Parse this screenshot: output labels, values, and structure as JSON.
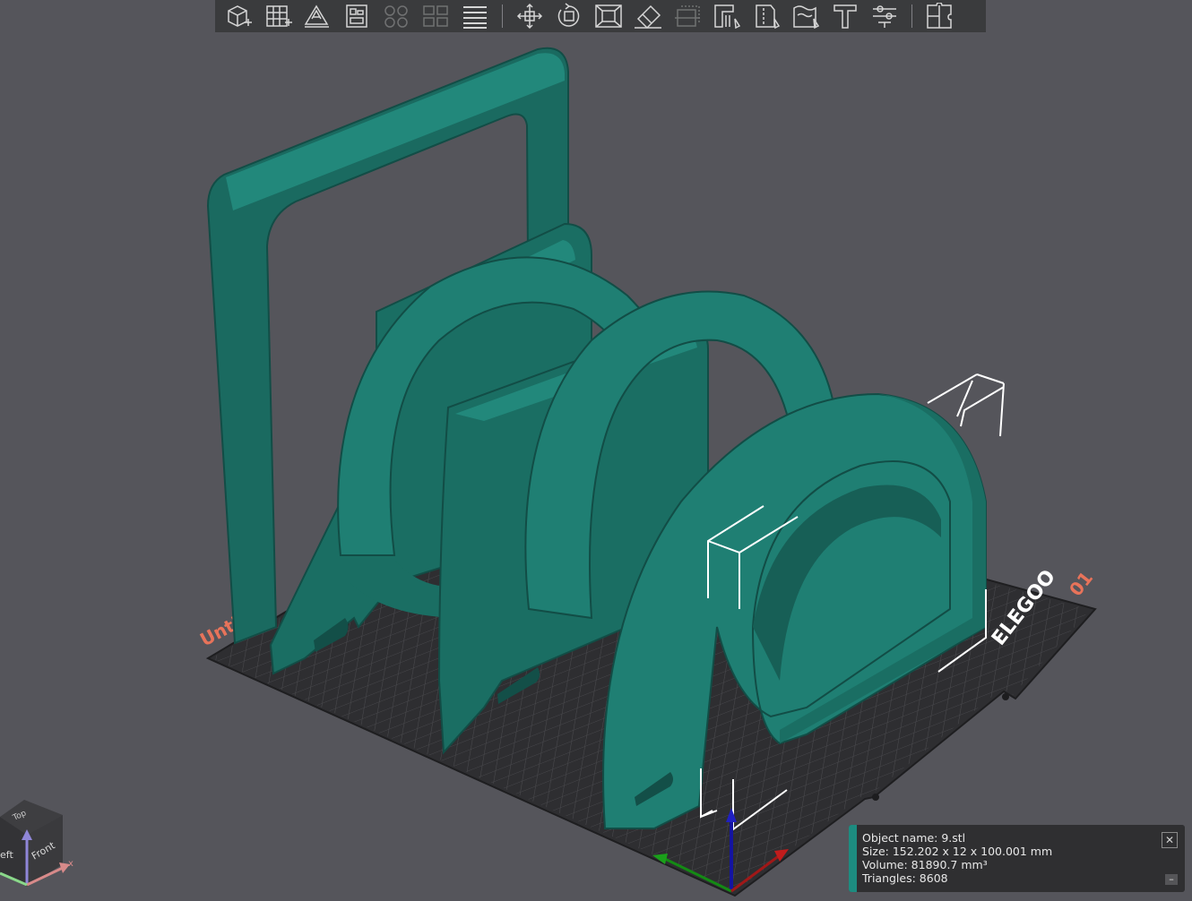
{
  "toolbar": {
    "buttons": [
      {
        "icon": "add-cube-icon",
        "enabled": true
      },
      {
        "icon": "add-plate-grid-icon",
        "enabled": true
      },
      {
        "icon": "auto-orient-icon",
        "enabled": true
      },
      {
        "icon": "arrange-icon",
        "enabled": true
      },
      {
        "icon": "split-objects-icon",
        "enabled": false
      },
      {
        "icon": "split-parts-icon",
        "enabled": false
      },
      {
        "icon": "layers-icon",
        "enabled": true
      },
      {
        "icon": "move-icon",
        "enabled": true
      },
      {
        "icon": "rotate-icon",
        "enabled": true
      },
      {
        "icon": "scale-icon",
        "enabled": true
      },
      {
        "icon": "lay-on-face-icon",
        "enabled": true
      },
      {
        "icon": "cut-icon",
        "enabled": false
      },
      {
        "icon": "support-paint-icon",
        "enabled": true
      },
      {
        "icon": "seam-paint-icon",
        "enabled": true
      },
      {
        "icon": "fuzzy-skin-icon",
        "enabled": true
      },
      {
        "icon": "text-emboss-icon",
        "enabled": true
      },
      {
        "icon": "measure-icon",
        "enabled": true
      },
      {
        "icon": "assembly-icon",
        "enabled": true
      }
    ]
  },
  "plate": {
    "brand": "ELEGOO",
    "plate_number": "01",
    "plate_name_fragment": "Unti",
    "accent_color": "#e8735a"
  },
  "model": {
    "color": "#1f7a6e"
  },
  "view_cube": {
    "top_label": "Top",
    "left_label": "eft",
    "front_label": "Front",
    "x_label": "x"
  },
  "object_info": {
    "name_line": "Object name: 9.stl",
    "size_line": "Size: 152.202 x 12 x 100.001 mm",
    "volume_line": "Volume: 81890.7 mm³",
    "triangles_line": "Triangles: 8608",
    "close_label": "✕",
    "collapse_label": "–",
    "accent_color": "#1d8c80"
  }
}
